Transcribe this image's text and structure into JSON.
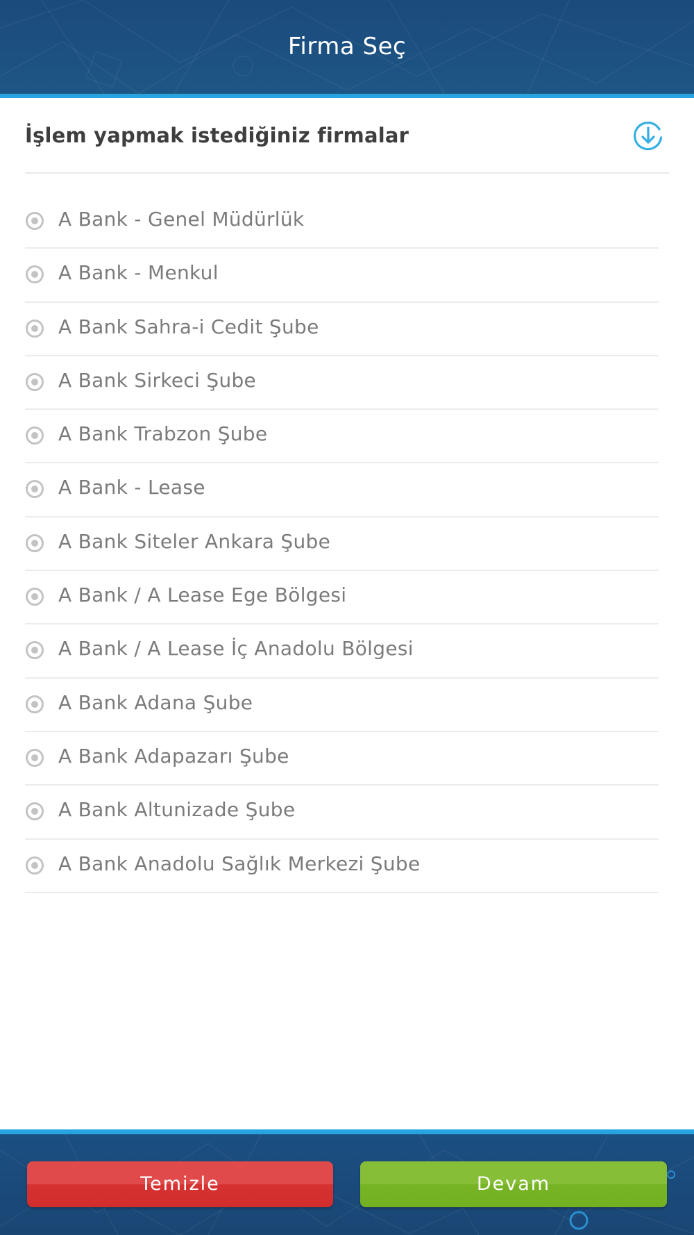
{
  "header": {
    "title": "Firma Seç"
  },
  "section": {
    "title": "İşlem yapmak istediğiniz firmalar",
    "action_icon": "download-circle-icon"
  },
  "companies": [
    {
      "label": "A Bank - Genel Müdürlük"
    },
    {
      "label": "A Bank - Menkul"
    },
    {
      "label": "A Bank Sahra-i Cedit Şube"
    },
    {
      "label": "A Bank Sirkeci Şube"
    },
    {
      "label": "A Bank Trabzon Şube"
    },
    {
      "label": "A Bank - Lease"
    },
    {
      "label": "A Bank Siteler Ankara Şube"
    },
    {
      "label": "A Bank / A Lease Ege Bölgesi"
    },
    {
      "label": "A Bank / A Lease İç Anadolu Bölgesi"
    },
    {
      "label": "A Bank Adana Şube"
    },
    {
      "label": "A Bank Adapazarı Şube"
    },
    {
      "label": "A Bank Altunizade Şube"
    },
    {
      "label": "A Bank Anadolu Sağlık Merkezi Şube"
    }
  ],
  "footer": {
    "clear_label": "Temizle",
    "continue_label": "Devam"
  },
  "colors": {
    "header_bg": "#1b4a7c",
    "accent_blue": "#27a3e0",
    "clear_red": "#d63232",
    "continue_green": "#76b325"
  }
}
